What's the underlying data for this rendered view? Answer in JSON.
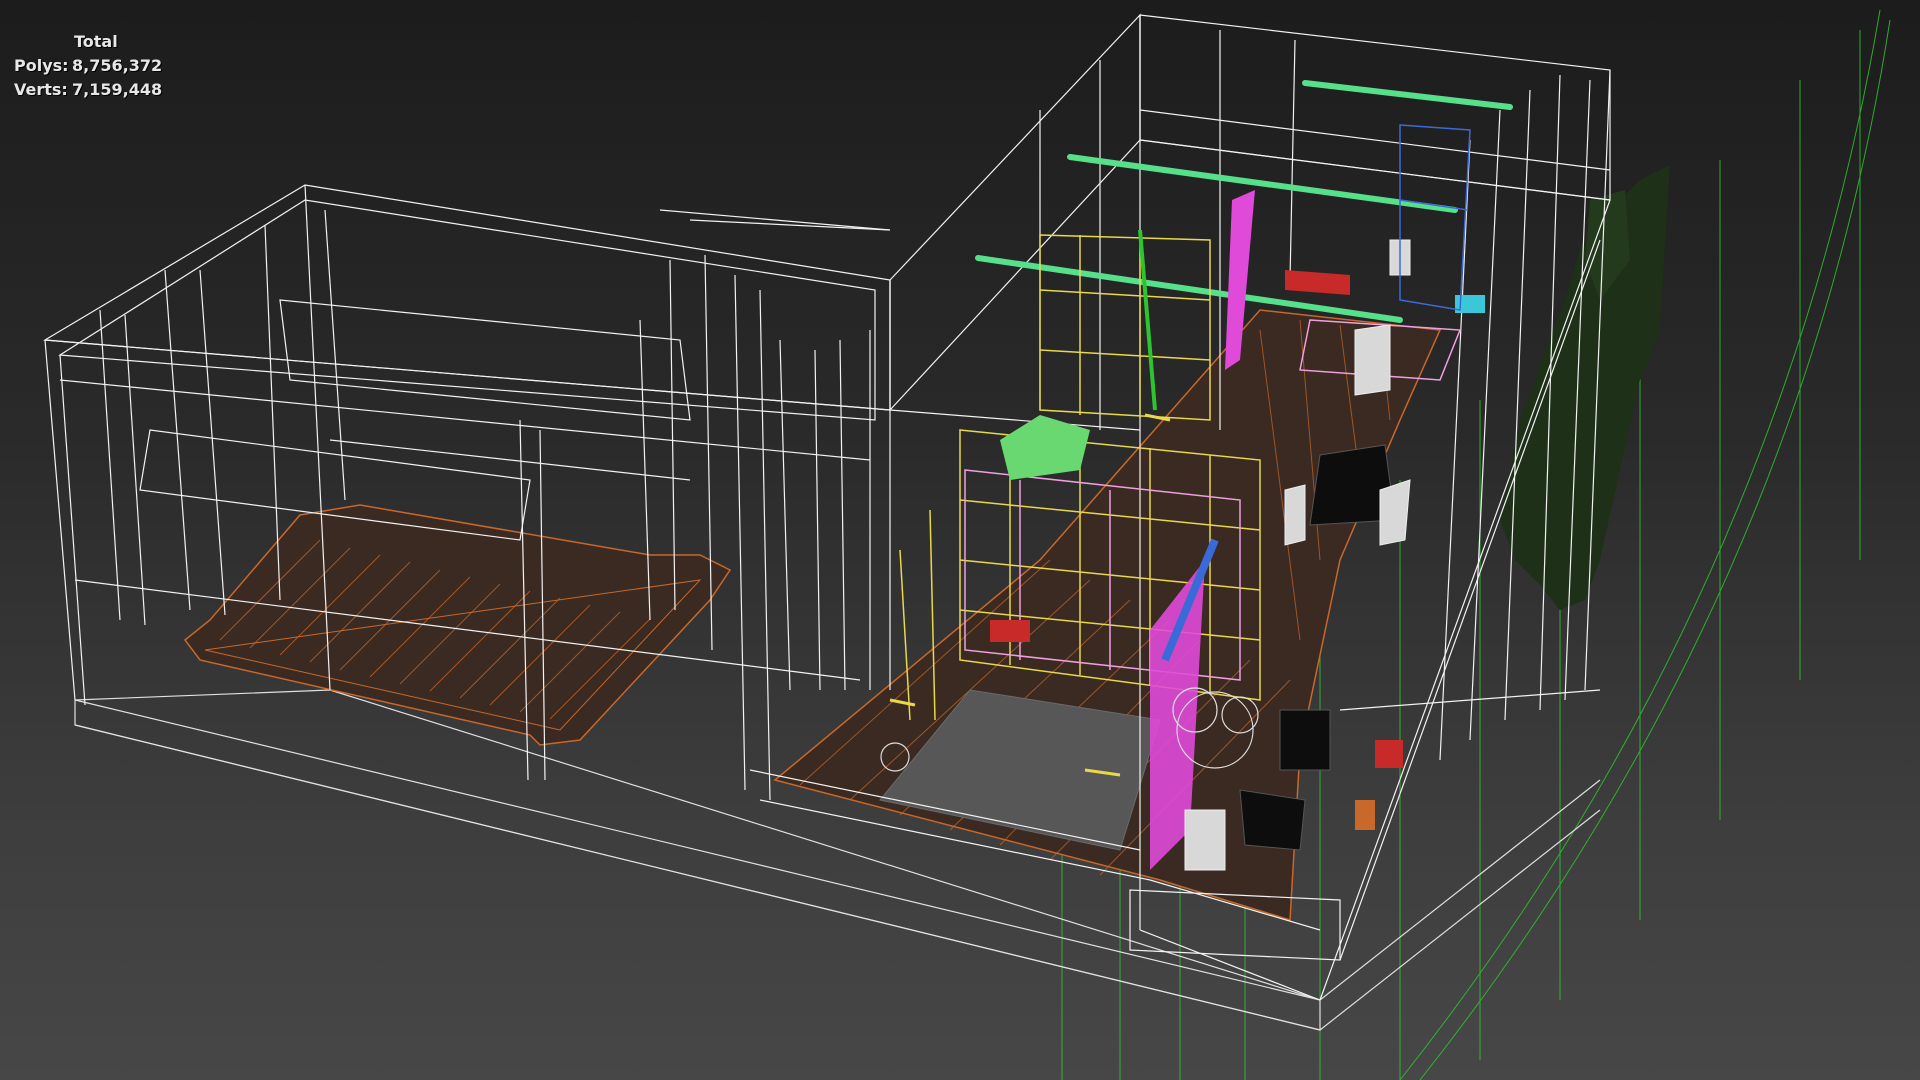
{
  "viewport": {
    "stats": {
      "title": "Total",
      "polys_label": "Polys:",
      "polys_value": "8,756,372",
      "verts_label": "Verts:",
      "verts_value": "7,159,448"
    }
  },
  "colors": {
    "wireframe": "#f2f2f2",
    "floor": "#c8682a",
    "yellow_shelves": "#e8d84a",
    "green_rails": "#56e08a",
    "magenta": "#e04ad8",
    "pink": "#f0a0e0",
    "blue": "#3a6ad8",
    "tree": "#1e3018",
    "camera_frustum": "#2ec42e"
  }
}
